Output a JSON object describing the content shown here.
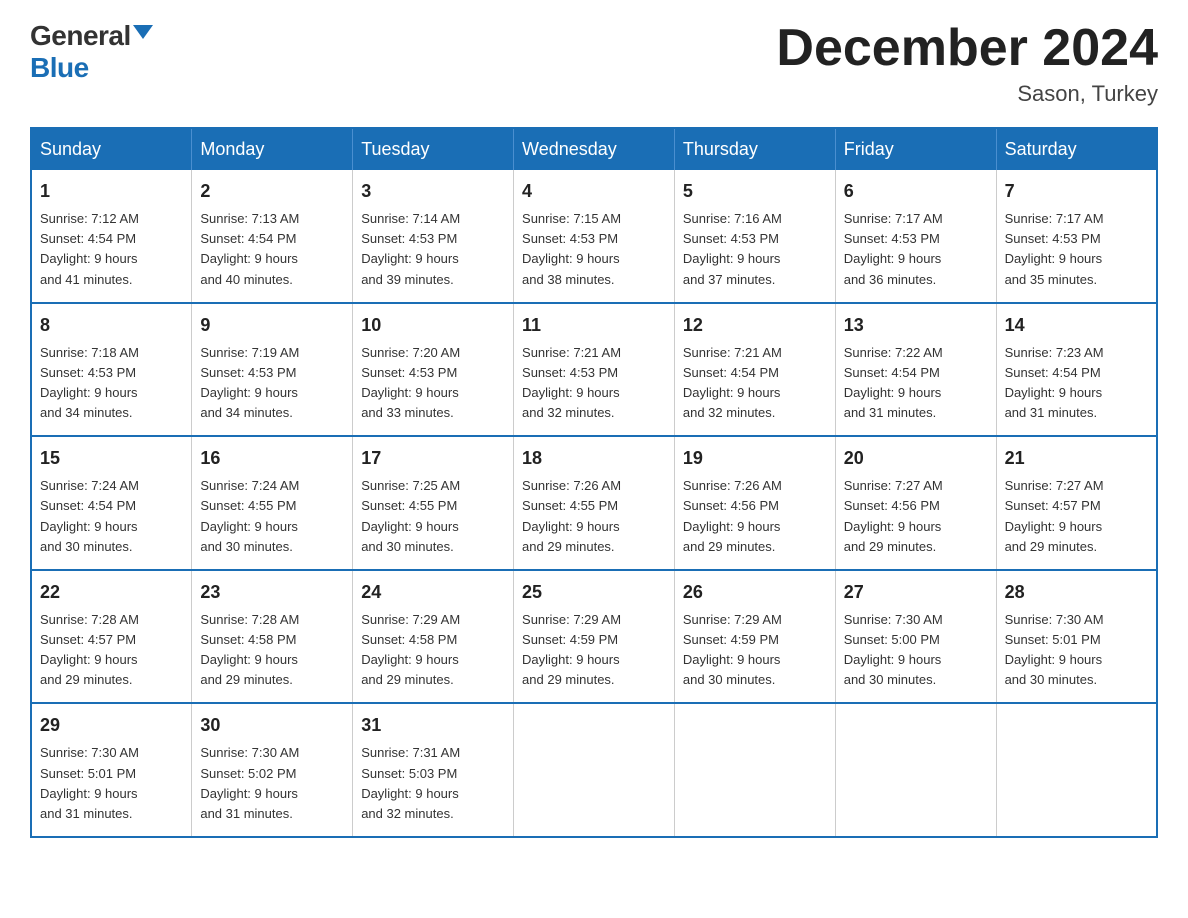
{
  "logo": {
    "general": "General",
    "blue": "Blue"
  },
  "title": "December 2024",
  "location": "Sason, Turkey",
  "days_of_week": [
    "Sunday",
    "Monday",
    "Tuesday",
    "Wednesday",
    "Thursday",
    "Friday",
    "Saturday"
  ],
  "weeks": [
    [
      {
        "day": "1",
        "sunrise": "7:12 AM",
        "sunset": "4:54 PM",
        "daylight": "9 hours and 41 minutes."
      },
      {
        "day": "2",
        "sunrise": "7:13 AM",
        "sunset": "4:54 PM",
        "daylight": "9 hours and 40 minutes."
      },
      {
        "day": "3",
        "sunrise": "7:14 AM",
        "sunset": "4:53 PM",
        "daylight": "9 hours and 39 minutes."
      },
      {
        "day": "4",
        "sunrise": "7:15 AM",
        "sunset": "4:53 PM",
        "daylight": "9 hours and 38 minutes."
      },
      {
        "day": "5",
        "sunrise": "7:16 AM",
        "sunset": "4:53 PM",
        "daylight": "9 hours and 37 minutes."
      },
      {
        "day": "6",
        "sunrise": "7:17 AM",
        "sunset": "4:53 PM",
        "daylight": "9 hours and 36 minutes."
      },
      {
        "day": "7",
        "sunrise": "7:17 AM",
        "sunset": "4:53 PM",
        "daylight": "9 hours and 35 minutes."
      }
    ],
    [
      {
        "day": "8",
        "sunrise": "7:18 AM",
        "sunset": "4:53 PM",
        "daylight": "9 hours and 34 minutes."
      },
      {
        "day": "9",
        "sunrise": "7:19 AM",
        "sunset": "4:53 PM",
        "daylight": "9 hours and 34 minutes."
      },
      {
        "day": "10",
        "sunrise": "7:20 AM",
        "sunset": "4:53 PM",
        "daylight": "9 hours and 33 minutes."
      },
      {
        "day": "11",
        "sunrise": "7:21 AM",
        "sunset": "4:53 PM",
        "daylight": "9 hours and 32 minutes."
      },
      {
        "day": "12",
        "sunrise": "7:21 AM",
        "sunset": "4:54 PM",
        "daylight": "9 hours and 32 minutes."
      },
      {
        "day": "13",
        "sunrise": "7:22 AM",
        "sunset": "4:54 PM",
        "daylight": "9 hours and 31 minutes."
      },
      {
        "day": "14",
        "sunrise": "7:23 AM",
        "sunset": "4:54 PM",
        "daylight": "9 hours and 31 minutes."
      }
    ],
    [
      {
        "day": "15",
        "sunrise": "7:24 AM",
        "sunset": "4:54 PM",
        "daylight": "9 hours and 30 minutes."
      },
      {
        "day": "16",
        "sunrise": "7:24 AM",
        "sunset": "4:55 PM",
        "daylight": "9 hours and 30 minutes."
      },
      {
        "day": "17",
        "sunrise": "7:25 AM",
        "sunset": "4:55 PM",
        "daylight": "9 hours and 30 minutes."
      },
      {
        "day": "18",
        "sunrise": "7:26 AM",
        "sunset": "4:55 PM",
        "daylight": "9 hours and 29 minutes."
      },
      {
        "day": "19",
        "sunrise": "7:26 AM",
        "sunset": "4:56 PM",
        "daylight": "9 hours and 29 minutes."
      },
      {
        "day": "20",
        "sunrise": "7:27 AM",
        "sunset": "4:56 PM",
        "daylight": "9 hours and 29 minutes."
      },
      {
        "day": "21",
        "sunrise": "7:27 AM",
        "sunset": "4:57 PM",
        "daylight": "9 hours and 29 minutes."
      }
    ],
    [
      {
        "day": "22",
        "sunrise": "7:28 AM",
        "sunset": "4:57 PM",
        "daylight": "9 hours and 29 minutes."
      },
      {
        "day": "23",
        "sunrise": "7:28 AM",
        "sunset": "4:58 PM",
        "daylight": "9 hours and 29 minutes."
      },
      {
        "day": "24",
        "sunrise": "7:29 AM",
        "sunset": "4:58 PM",
        "daylight": "9 hours and 29 minutes."
      },
      {
        "day": "25",
        "sunrise": "7:29 AM",
        "sunset": "4:59 PM",
        "daylight": "9 hours and 29 minutes."
      },
      {
        "day": "26",
        "sunrise": "7:29 AM",
        "sunset": "4:59 PM",
        "daylight": "9 hours and 30 minutes."
      },
      {
        "day": "27",
        "sunrise": "7:30 AM",
        "sunset": "5:00 PM",
        "daylight": "9 hours and 30 minutes."
      },
      {
        "day": "28",
        "sunrise": "7:30 AM",
        "sunset": "5:01 PM",
        "daylight": "9 hours and 30 minutes."
      }
    ],
    [
      {
        "day": "29",
        "sunrise": "7:30 AM",
        "sunset": "5:01 PM",
        "daylight": "9 hours and 31 minutes."
      },
      {
        "day": "30",
        "sunrise": "7:30 AM",
        "sunset": "5:02 PM",
        "daylight": "9 hours and 31 minutes."
      },
      {
        "day": "31",
        "sunrise": "7:31 AM",
        "sunset": "5:03 PM",
        "daylight": "9 hours and 32 minutes."
      },
      null,
      null,
      null,
      null
    ]
  ],
  "labels": {
    "sunrise": "Sunrise:",
    "sunset": "Sunset:",
    "daylight": "Daylight:"
  }
}
